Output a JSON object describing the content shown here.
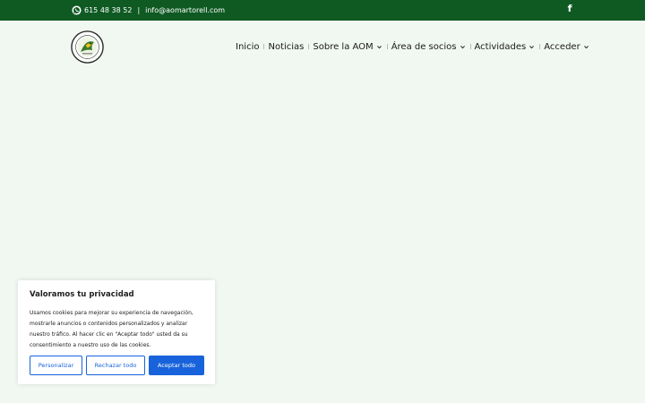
{
  "topbar": {
    "phone": "615 48 38 52",
    "separator": "|",
    "email": "info@aomartorell.com",
    "social_icon": "facebook-icon",
    "contact_icon": "whatsapp-icon",
    "background_color": "#0f5a23"
  },
  "header": {
    "logo_icon": "aom-circular-emblem",
    "nav": [
      {
        "label": "Inicio",
        "dropdown": false
      },
      {
        "label": "Noticias",
        "dropdown": false
      },
      {
        "label": "Sobre la AOM",
        "dropdown": true
      },
      {
        "label": "Área de socios",
        "dropdown": true
      },
      {
        "label": "Actividades",
        "dropdown": true
      },
      {
        "label": "Acceder",
        "dropdown": true
      }
    ]
  },
  "cookie_banner": {
    "title": "Valoramos tu privacidad",
    "text": "Usamos cookies para mejorar su experiencia de navegación, mostrarle anuncios o contenidos personalizados y analizar nuestro tráfico. Al hacer clic en \"Aceptar todo\" usted da su consentimiento a nuestro uso de las cookies.",
    "customize_label": "Personalizar",
    "reject_label": "Rechazar todo",
    "accept_label": "Aceptar todo",
    "accent_color": "#1863dc"
  }
}
